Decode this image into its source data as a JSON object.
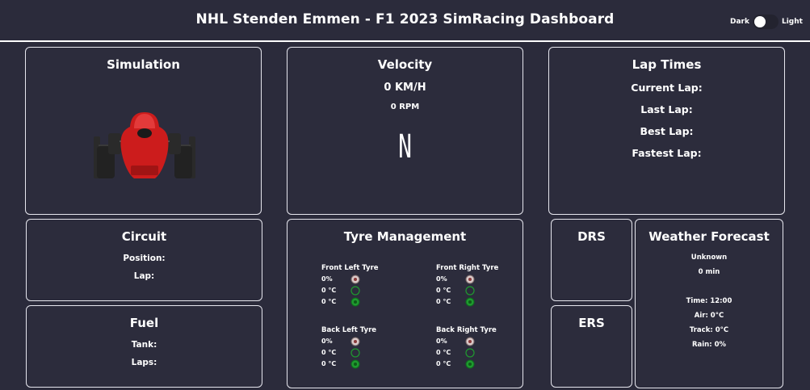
{
  "header": {
    "title": "NHL Stenden Emmen - F1 2023 SimRacing Dashboard",
    "theme_dark_label": "Dark",
    "theme_light_label": "Light"
  },
  "simulation": {
    "title": "Simulation"
  },
  "velocity": {
    "title": "Velocity",
    "speed": "0 KM/H",
    "rpm": "0 RPM",
    "gear": "N"
  },
  "lap_times": {
    "title": "Lap Times",
    "current": "Current Lap:",
    "last": "Last Lap:",
    "best": "Best Lap:",
    "fastest": "Fastest Lap:"
  },
  "circuit": {
    "title": "Circuit",
    "position": "Position:",
    "lap": "Lap:"
  },
  "fuel": {
    "title": "Fuel",
    "tank": "Tank:",
    "laps": "Laps:"
  },
  "tyres": {
    "title": "Tyre Management",
    "front_left": {
      "name": "Front Left Tyre",
      "wear": "0%",
      "temp1": "0 °C",
      "temp2": "0 °C"
    },
    "front_right": {
      "name": "Front Right Tyre",
      "wear": "0%",
      "temp1": "0 °C",
      "temp2": "0 °C"
    },
    "back_left": {
      "name": "Back Left Tyre",
      "wear": "0%",
      "temp1": "0 °C",
      "temp2": "0 °C"
    },
    "back_right": {
      "name": "Back Right Tyre",
      "wear": "0%",
      "temp1": "0 °C",
      "temp2": "0 °C"
    }
  },
  "drs": {
    "title": "DRS"
  },
  "ers": {
    "title": "ERS"
  },
  "weather": {
    "title": "Weather Forecast",
    "condition": "Unknown",
    "offset": "0 min",
    "time": "Time: 12:00",
    "air": "Air: 0°C",
    "track": "Track: 0°C",
    "rain": "Rain: 0%"
  },
  "colors": {
    "background": "#2b2b3b",
    "border": "#e6e6ee",
    "car_red": "#d42020",
    "tyre_green": "#1f9a2f"
  }
}
